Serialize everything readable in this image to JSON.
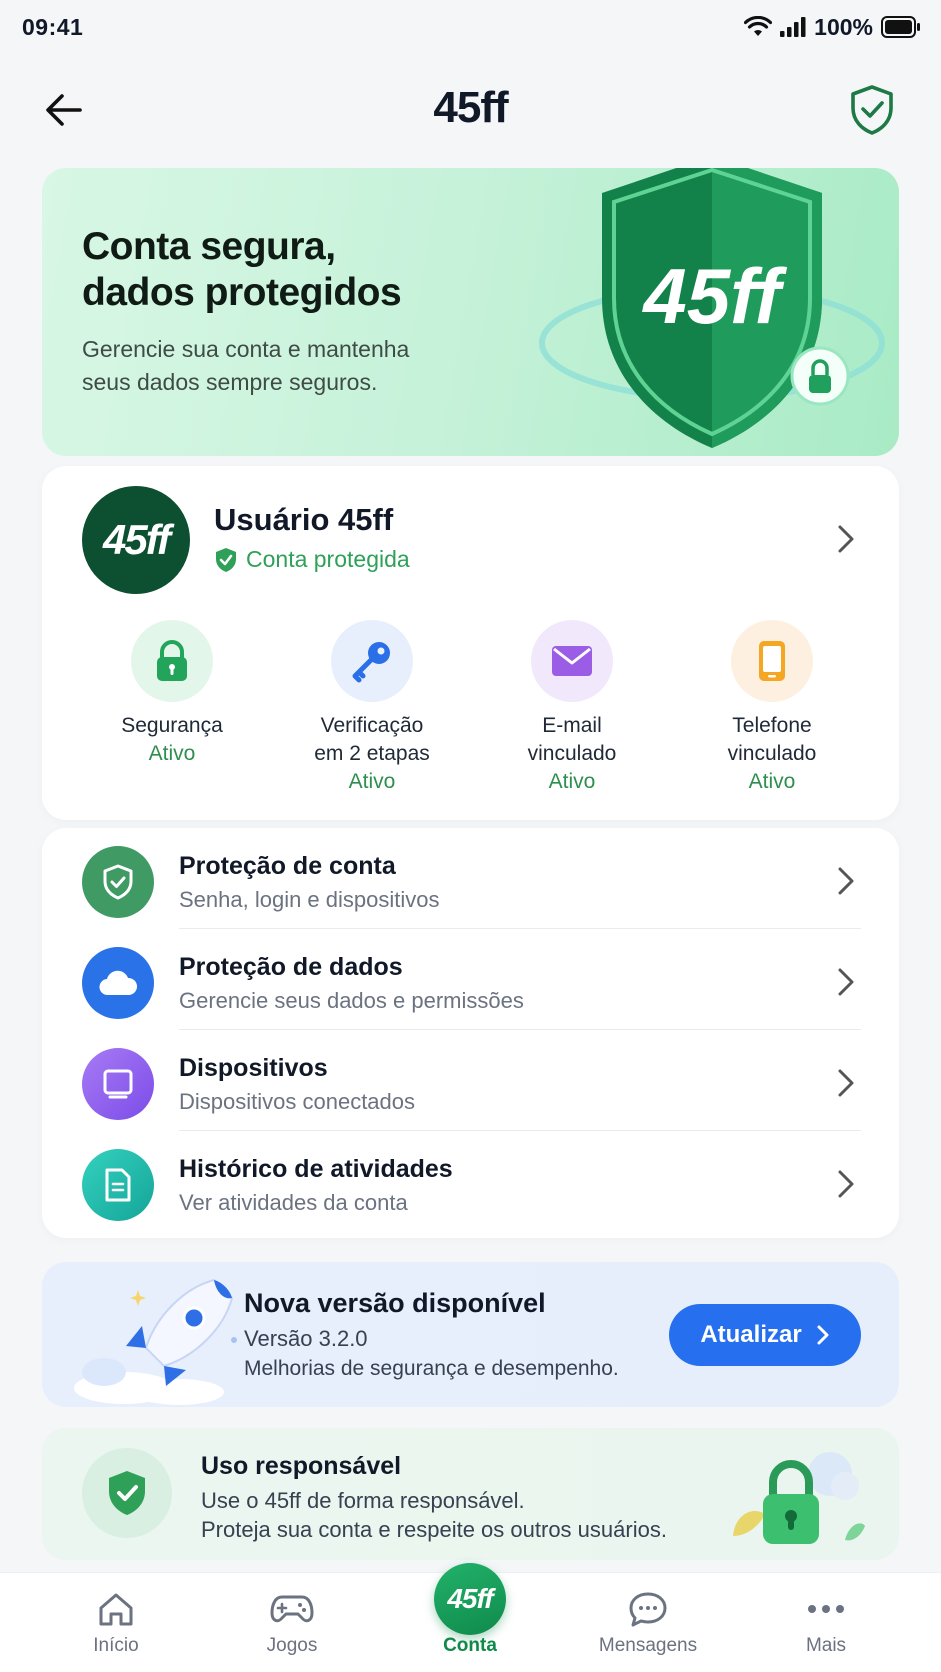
{
  "status_bar": {
    "time": "09:41",
    "battery": "100%"
  },
  "header": {
    "title": "45ff"
  },
  "hero": {
    "title_line1": "Conta segura,",
    "title_line2": "dados protegidos",
    "subtitle_line1": "Gerencie sua conta e mantenha",
    "subtitle_line2": "seus dados sempre seguros.",
    "badge_text": "45ff"
  },
  "profile": {
    "avatar_text": "45ff",
    "name": "Usuário 45ff",
    "status": "Conta protegida",
    "features": [
      {
        "label": "Segurança",
        "status": "Ativo",
        "icon": "lock-icon",
        "bg": "#e3f6ea",
        "color": "#22a45a"
      },
      {
        "label": "Verificação\nem 2 etapas",
        "status": "Ativo",
        "icon": "key-icon",
        "bg": "#e7effd",
        "color": "#2a6fe8"
      },
      {
        "label": "E-mail\nvinculado",
        "status": "Ativo",
        "icon": "mail-icon",
        "bg": "#f1e8fc",
        "color": "#9b5de5"
      },
      {
        "label": "Telefone\nvinculado",
        "status": "Ativo",
        "icon": "phone-icon",
        "bg": "#fdf0e1",
        "color": "#f5a623"
      }
    ]
  },
  "menu": [
    {
      "title": "Proteção de conta",
      "subtitle": "Senha, login e dispositivos",
      "icon": "shield-check-icon",
      "color": "#3f9a63"
    },
    {
      "title": "Proteção de dados",
      "subtitle": "Gerencie seus dados e permissões",
      "icon": "cloud-icon",
      "color": "#2a72e8"
    },
    {
      "title": "Dispositivos",
      "subtitle": "Dispositivos conectados",
      "icon": "tablet-icon",
      "color": "#8b5cf6"
    },
    {
      "title": "Histórico de atividades",
      "subtitle": "Ver atividades da conta",
      "icon": "document-icon",
      "color": "#1fb8a8"
    }
  ],
  "update": {
    "title": "Nova versão disponível",
    "version": "Versão 3.2.0",
    "description": "Melhorias de segurança e desempenho.",
    "button": "Atualizar"
  },
  "responsible": {
    "title": "Uso responsável",
    "line1": "Use o 45ff de forma responsável.",
    "line2": "Proteja sua conta e respeite os outros usuários."
  },
  "tabs": [
    {
      "label": "Início",
      "icon": "home-icon"
    },
    {
      "label": "Jogos",
      "icon": "gamepad-icon"
    },
    {
      "label": "Conta",
      "icon": "account-badge-icon",
      "active": true,
      "badge_text": "45ff"
    },
    {
      "label": "Mensagens",
      "icon": "chat-icon"
    },
    {
      "label": "Mais",
      "icon": "more-icon"
    }
  ],
  "colors": {
    "brand_green": "#0f8a4b",
    "accent_blue": "#2670f0",
    "status_green": "#2fa058"
  }
}
